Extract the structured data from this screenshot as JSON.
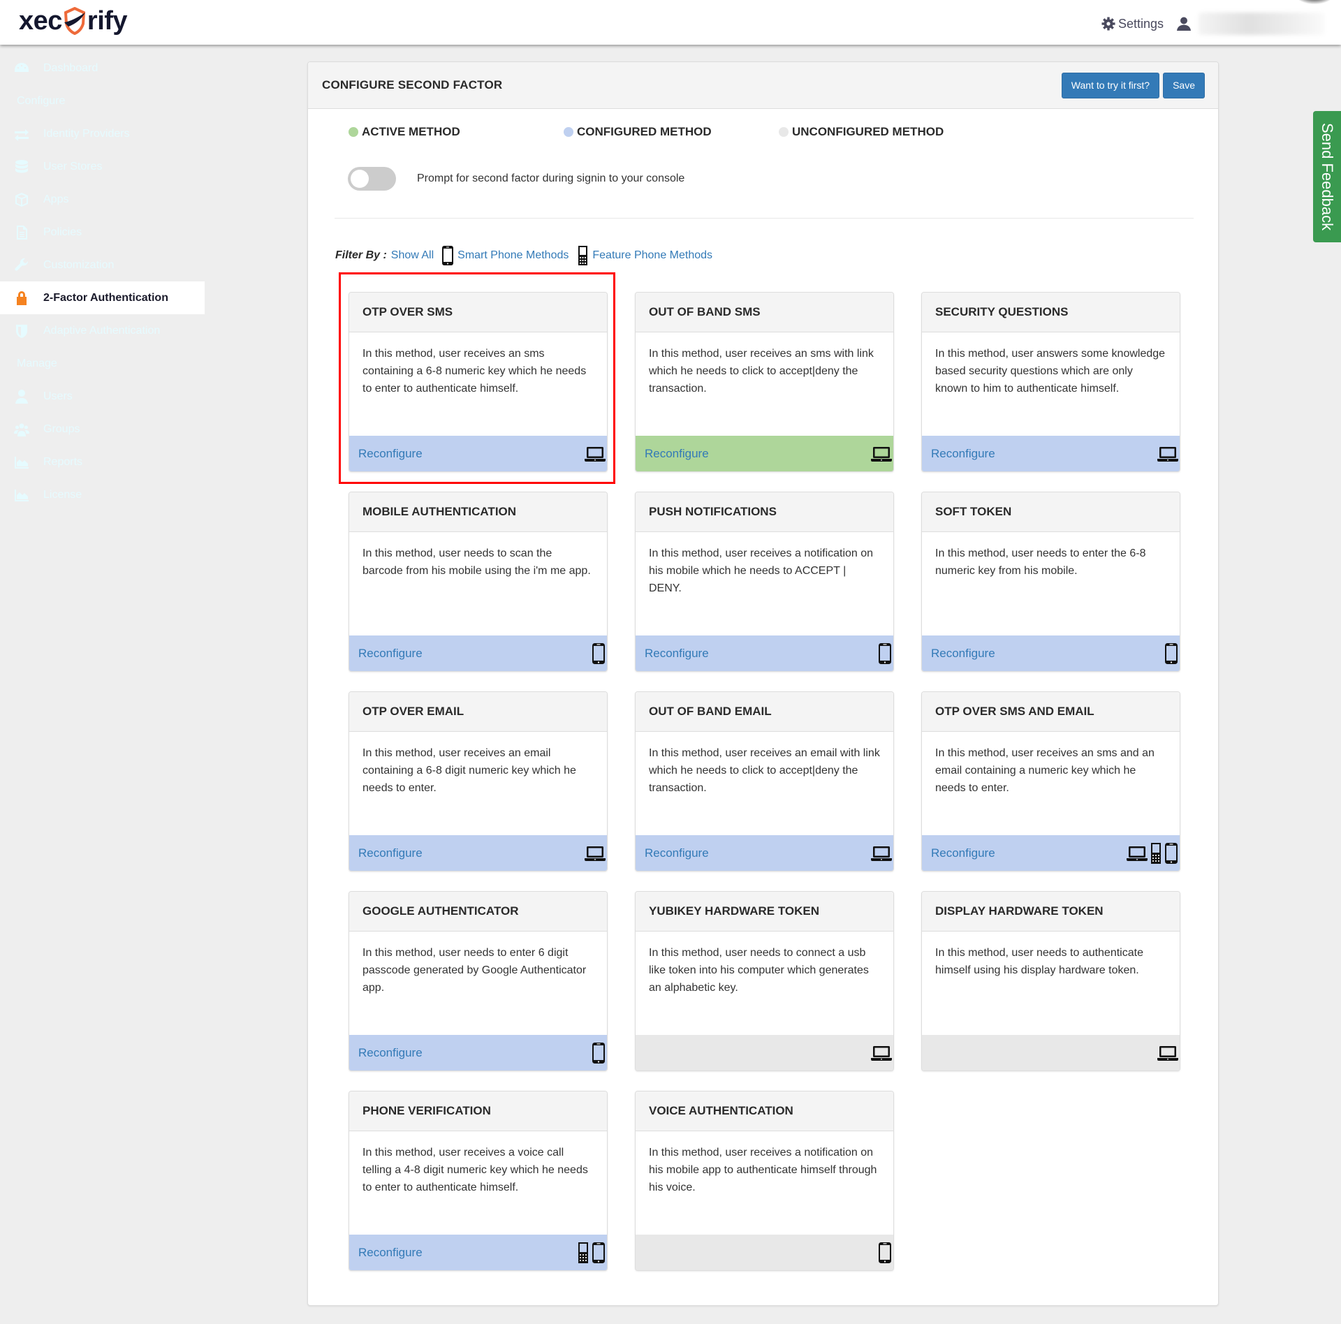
{
  "header": {
    "logo_left": "xec",
    "logo_right": "rify",
    "settings_label": "Settings",
    "settings_icon": "gear-icon",
    "user_icon": "user-icon"
  },
  "sidebar": {
    "items": [
      {
        "type": "item",
        "label": "Dashboard",
        "icon": "dashboard-icon",
        "active": false
      },
      {
        "type": "section",
        "label": "Configure"
      },
      {
        "type": "item",
        "label": "Identity Providers",
        "icon": "exchange-icon",
        "active": false
      },
      {
        "type": "item",
        "label": "User Stores",
        "icon": "database-icon",
        "active": false
      },
      {
        "type": "item",
        "label": "Apps",
        "icon": "cube-icon",
        "active": false
      },
      {
        "type": "item",
        "label": "Policies",
        "icon": "document-icon",
        "active": false
      },
      {
        "type": "item",
        "label": "Customization",
        "icon": "wrench-icon",
        "active": false
      },
      {
        "type": "item",
        "label": "2-Factor Authentication",
        "icon": "lock-icon",
        "active": true
      },
      {
        "type": "item",
        "label": "Adaptive Authentication",
        "icon": "shield-icon",
        "active": false
      },
      {
        "type": "section",
        "label": "Manage"
      },
      {
        "type": "item",
        "label": "Users",
        "icon": "user-icon",
        "active": false
      },
      {
        "type": "item",
        "label": "Groups",
        "icon": "group-icon",
        "active": false
      },
      {
        "type": "item",
        "label": "Reports",
        "icon": "area-chart-icon",
        "active": false
      },
      {
        "type": "item",
        "label": "License",
        "icon": "area-chart-icon",
        "active": false
      }
    ]
  },
  "panel": {
    "title": "CONFIGURE SECOND FACTOR",
    "try_button": "Want to try it first?",
    "save_button": "Save"
  },
  "legend": [
    {
      "label": "ACTIVE METHOD",
      "color": "#aed69a"
    },
    {
      "label": "CONFIGURED METHOD",
      "color": "#bfd0f0"
    },
    {
      "label": "UNCONFIGURED METHOD",
      "color": "#e8e8e8"
    }
  ],
  "toggle": {
    "label": "Prompt for second factor during signin to your console",
    "on": false
  },
  "filter": {
    "label": "Filter By :",
    "show_all": "Show All",
    "smart_phone": "Smart Phone Methods",
    "feature_phone": "Feature Phone Methods"
  },
  "status_colors": {
    "active": "#aed69a",
    "configured": "#bfd0f0",
    "unconfigured": "#e8e8e8",
    "link": "#337ab7",
    "button": "#337ab7",
    "feedback": "#3a9a50",
    "highlight": "#ff0000"
  },
  "reconfigure_label": "Reconfigure",
  "methods": [
    {
      "title": "OTP OVER SMS",
      "description": "In this method, user receives an sms containing a 6-8 numeric key which he needs to enter to authenticate himself.",
      "status": "configured",
      "devices": [
        "laptop"
      ],
      "highlighted": true
    },
    {
      "title": "OUT OF BAND SMS",
      "description": "In this method, user receives an sms with link which he needs to click to accept|deny the transaction.",
      "status": "active",
      "devices": [
        "laptop"
      ]
    },
    {
      "title": "SECURITY QUESTIONS",
      "description": "In this method, user answers some knowledge based security questions which are only known to him to authenticate himself.",
      "status": "configured",
      "devices": [
        "laptop"
      ]
    },
    {
      "title": "MOBILE AUTHENTICATION",
      "description": "In this method, user needs to scan the barcode from his mobile using the i'm me app.",
      "status": "configured",
      "devices": [
        "smartphone"
      ]
    },
    {
      "title": "PUSH NOTIFICATIONS",
      "description": "In this method, user receives a notification on his mobile which he needs to ACCEPT | DENY.",
      "status": "configured",
      "devices": [
        "smartphone"
      ]
    },
    {
      "title": "SOFT TOKEN",
      "description": "In this method, user needs to enter the 6-8 numeric key from his mobile.",
      "status": "configured",
      "devices": [
        "smartphone"
      ]
    },
    {
      "title": "OTP OVER EMAIL",
      "description": "In this method, user receives an email containing a 6-8 digit numeric key which he needs to enter.",
      "status": "configured",
      "devices": [
        "laptop"
      ]
    },
    {
      "title": "OUT OF BAND EMAIL",
      "description": "In this method, user receives an email with link which he needs to click to accept|deny the transaction.",
      "status": "configured",
      "devices": [
        "laptop"
      ]
    },
    {
      "title": "OTP OVER SMS AND EMAIL",
      "description": "In this method, user receives an sms and an email containing a numeric key which he needs to enter.",
      "status": "configured",
      "devices": [
        "laptop",
        "featurephone",
        "smartphone"
      ]
    },
    {
      "title": "GOOGLE AUTHENTICATOR",
      "description": "In this method, user needs to enter 6 digit passcode generated by Google Authenticator app.",
      "status": "configured",
      "devices": [
        "smartphone"
      ]
    },
    {
      "title": "YUBIKEY HARDWARE TOKEN",
      "description": "In this method, user needs to connect a usb like token into his computer which generates an alphabetic key.",
      "status": "unconfigured",
      "devices": [
        "laptop"
      ]
    },
    {
      "title": "DISPLAY HARDWARE TOKEN",
      "description": "In this method, user needs to authenticate himself using his display hardware token.",
      "status": "unconfigured",
      "devices": [
        "laptop"
      ]
    },
    {
      "title": "PHONE VERIFICATION",
      "description": "In this method, user receives a voice call telling a 4-8 digit numeric key which he needs to enter to authenticate himself.",
      "status": "configured",
      "devices": [
        "featurephone",
        "smartphone"
      ]
    },
    {
      "title": "VOICE AUTHENTICATION",
      "description": "In this method, user receives a notification on his mobile app to authenticate himself through his voice.",
      "status": "unconfigured",
      "devices": [
        "smartphone"
      ]
    }
  ],
  "feedback_tab": "Send Feedback"
}
